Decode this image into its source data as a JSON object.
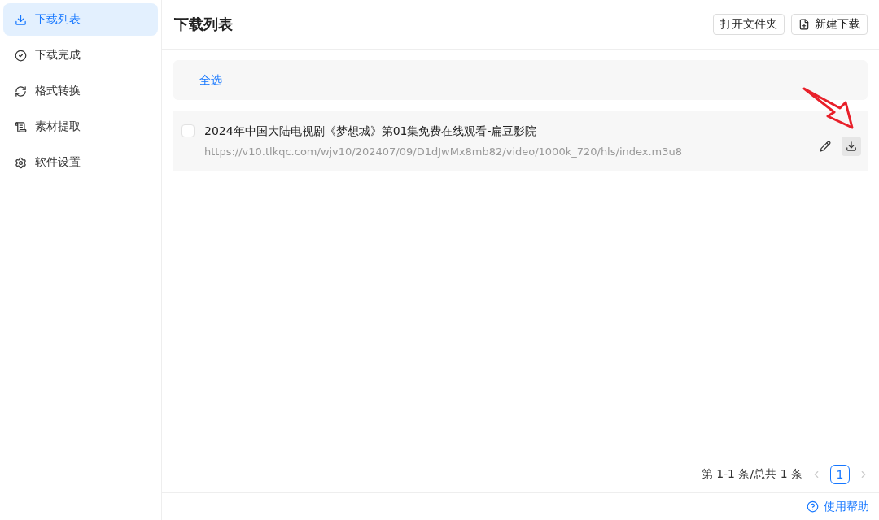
{
  "sidebar": {
    "items": [
      {
        "label": "下载列表",
        "selected": true
      },
      {
        "label": "下载完成",
        "selected": false
      },
      {
        "label": "格式转换",
        "selected": false
      },
      {
        "label": "素材提取",
        "selected": false
      },
      {
        "label": "软件设置",
        "selected": false
      }
    ]
  },
  "header": {
    "title": "下载列表",
    "buttons": [
      "打开文件夹",
      "新建下载"
    ]
  },
  "toolbar": {
    "select_all": "全选"
  },
  "downloads": [
    {
      "title": "2024年中国大陆电视剧《梦想城》第01集免费在线观看-扁豆影院",
      "url": "https://v10.tlkqc.com/wjv10/202407/09/D1dJwMx8mb82/video/1000k_720/hls/index.m3u8",
      "checked": false,
      "hovered_action": true
    }
  ],
  "pagination": {
    "summary": "第 1-1 条/总共 1 条",
    "prev_disabled": true,
    "next_disabled": true,
    "pages": [
      {
        "label": "1",
        "selected": true
      }
    ]
  },
  "footer": {
    "help": "使用帮助"
  }
}
